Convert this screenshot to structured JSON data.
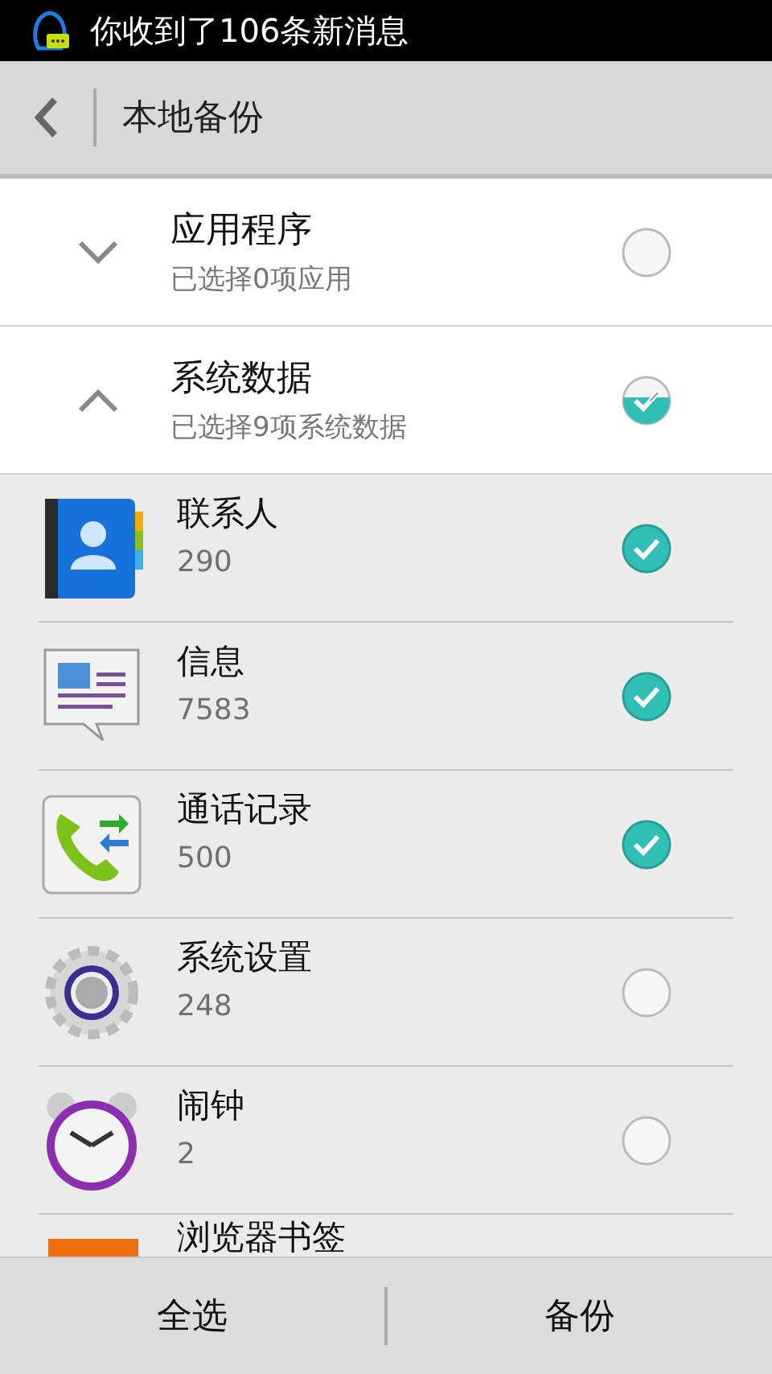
{
  "status_bar": {
    "notification": "你收到了106条新消息"
  },
  "header": {
    "title": "本地备份"
  },
  "groups": [
    {
      "title": "应用程序",
      "subtitle": "已选择0项应用",
      "expanded": false,
      "checked": false
    },
    {
      "title": "系统数据",
      "subtitle": "已选择9项系统数据",
      "expanded": true,
      "checked": true,
      "partial": true,
      "items": [
        {
          "kind": "contacts",
          "name": "联系人",
          "count": "290",
          "checked": true
        },
        {
          "kind": "messages",
          "name": "信息",
          "count": "7583",
          "checked": true
        },
        {
          "kind": "calls",
          "name": "通话记录",
          "count": "500",
          "checked": true
        },
        {
          "kind": "settings",
          "name": "系统设置",
          "count": "248",
          "checked": false
        },
        {
          "kind": "alarm",
          "name": "闹钟",
          "count": "2",
          "checked": false
        },
        {
          "kind": "bookmarks",
          "name": "浏览器书签"
        }
      ]
    }
  ],
  "bottom_bar": {
    "buttons": [
      "全选",
      "备份"
    ]
  }
}
